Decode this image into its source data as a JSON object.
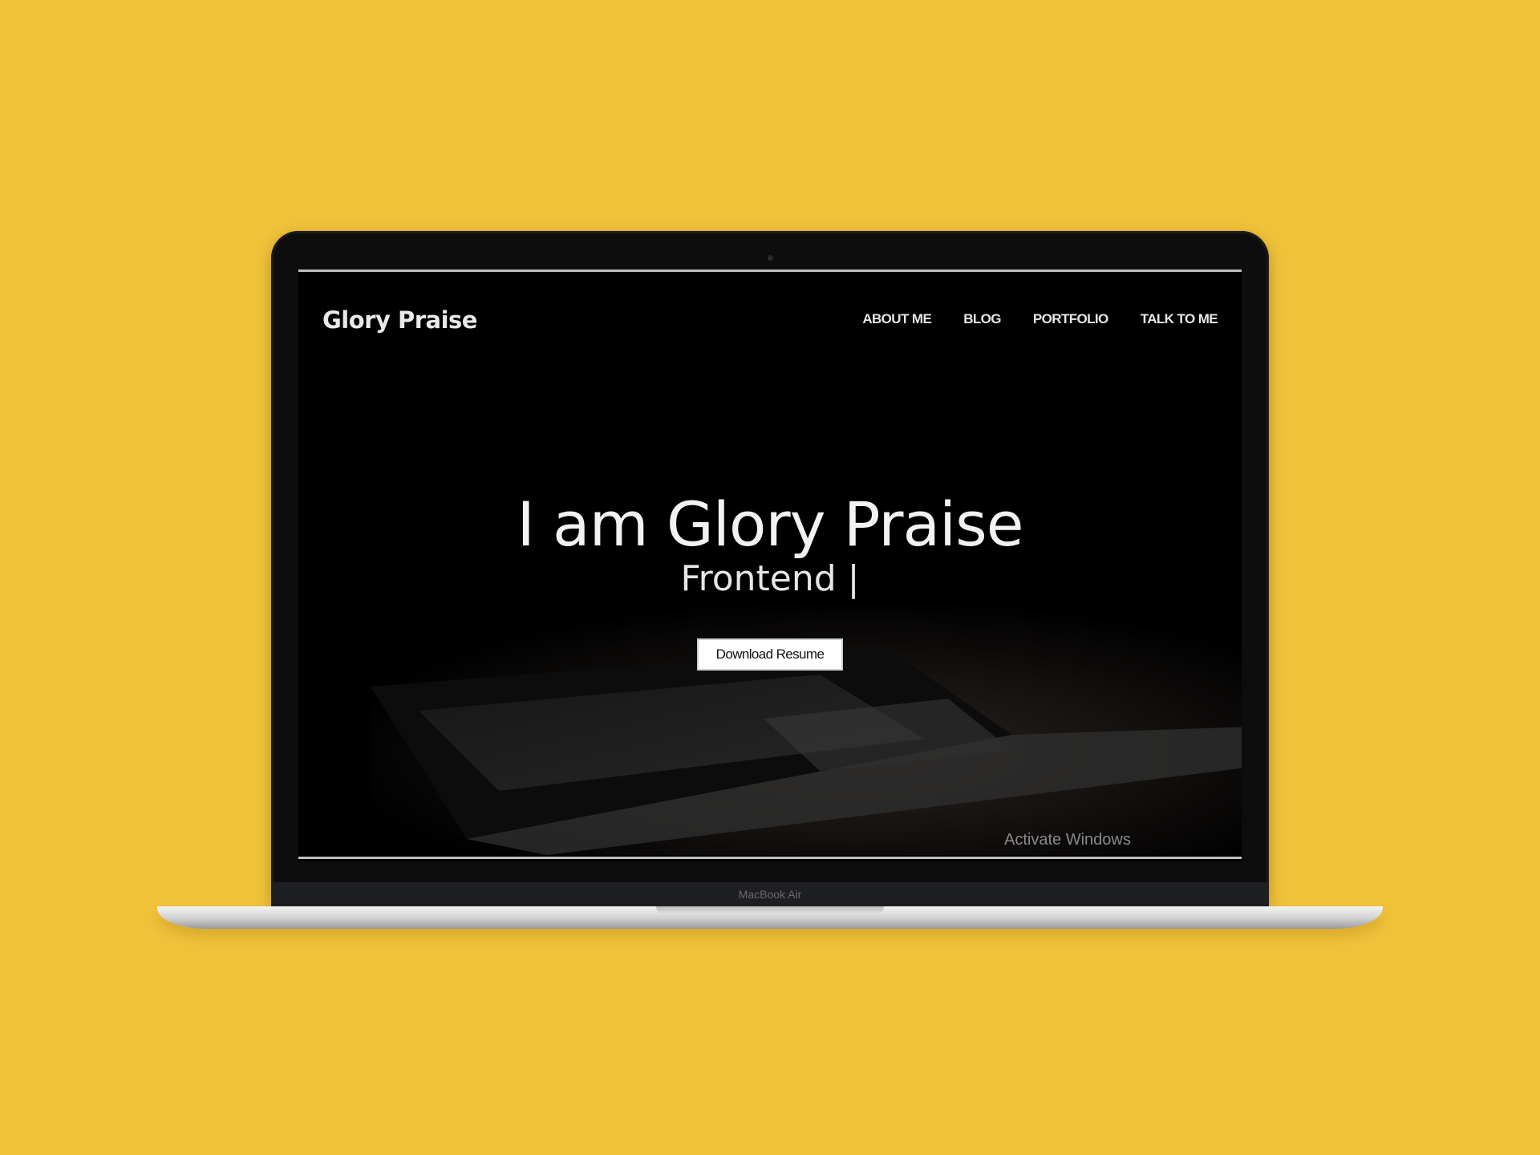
{
  "colors": {
    "background": "#F0C23A",
    "screen": "#000000",
    "text": "#F2F2F2"
  },
  "site": {
    "logo": "Glory Praise",
    "nav": [
      {
        "label": "ABOUT ME"
      },
      {
        "label": "BLOG"
      },
      {
        "label": "PORTFOLIO"
      },
      {
        "label": "TALK TO ME"
      }
    ],
    "hero_title": "I am Glory Praise",
    "hero_subtitle": "Frontend |",
    "resume_button": "Download Resume",
    "watermark": "Activate Windows"
  },
  "device": {
    "model_label": "MacBook Air"
  }
}
